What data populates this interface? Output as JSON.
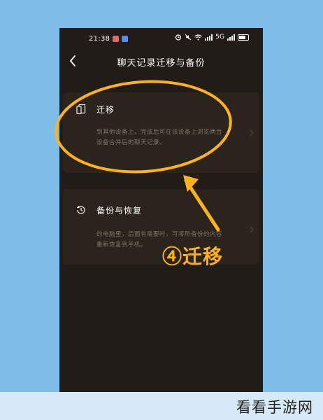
{
  "status_bar": {
    "time": "21:38",
    "app_icon_colors": [
      "#e46a62",
      "#5a8dea"
    ],
    "network_label": "5G"
  },
  "header": {
    "title": "聊天记录迁移与备份",
    "back_icon": "chevron-left-icon"
  },
  "options": [
    {
      "title": "迁移",
      "icon": "phone-transfer-icon",
      "description": "到其他设备上。完成后可在该设备上浏览两台设备合并后的聊天记录。"
    },
    {
      "title": "备份与恢复",
      "icon": "history-clock-icon",
      "description": "的电脑里，后面有需要时，可将所备份的内容重新恢复到手机。"
    }
  ],
  "annotation": {
    "label": "④迁移",
    "color": "#ffb21a"
  },
  "watermark": {
    "text": "看看手游网"
  },
  "colors": {
    "backdrop": "#7fbde9",
    "screen_bg": "#211c17",
    "card_bg": "#2a241d",
    "accent": "#ffb21a"
  }
}
